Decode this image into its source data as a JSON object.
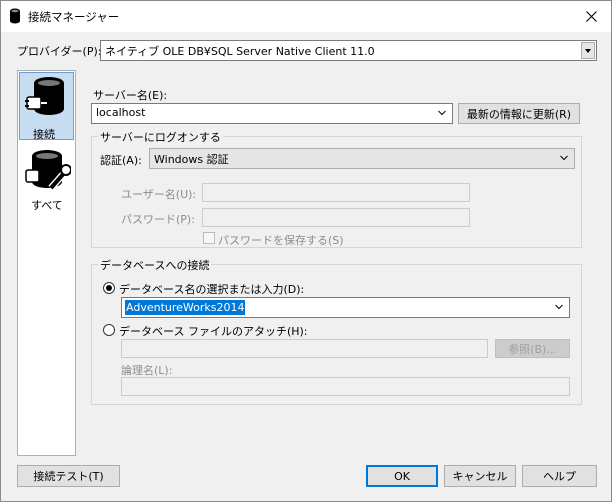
{
  "window": {
    "title": "接続マネージャー"
  },
  "provider": {
    "label": "プロバイダー(P):",
    "value": "ネイティブ OLE DB¥SQL Server Native Client 11.0"
  },
  "nav": {
    "items": [
      {
        "label": "接続",
        "icon": "database-plug-icon",
        "selected": true
      },
      {
        "label": "すべて",
        "icon": "database-wrench-icon",
        "selected": false
      }
    ]
  },
  "server": {
    "label": "サーバー名(E):",
    "value": "localhost",
    "refresh_label": "最新の情報に更新(R)"
  },
  "logon": {
    "group_label": "サーバーにログオンする",
    "auth_label": "認証(A):",
    "auth_value": "Windows 認証",
    "username_label": "ユーザー名(U):",
    "username_value": "",
    "password_label": "パスワード(P):",
    "password_value": "",
    "save_password_label": "パスワードを保存する(S)",
    "save_password_checked": false
  },
  "database": {
    "group_label": "データベースへの接続",
    "select_label": "データベース名の選択または入力(D):",
    "select_value": "AdventureWorks2014",
    "attach_label": "データベース ファイルのアタッチ(H):",
    "attach_value": "",
    "browse_label": "参照(B)...",
    "logical_name_label": "論理名(L):",
    "logical_name_value": ""
  },
  "footer": {
    "test_label": "接続テスト(T)",
    "ok_label": "OK",
    "cancel_label": "キャンセル",
    "help_label": "ヘルプ"
  },
  "colors": {
    "accent": "#0078d7",
    "selection": "#0078d7",
    "nav_selected_bg": "#c7ddf2"
  }
}
